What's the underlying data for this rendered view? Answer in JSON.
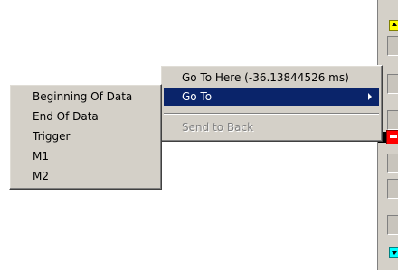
{
  "context_menu": {
    "go_to_here": "Go To Here (-36.13844526 ms)",
    "go_to": "Go To",
    "send_to_back": "Send to Back"
  },
  "go_to_submenu": {
    "items": [
      "Beginning Of Data",
      "End Of Data",
      "Trigger",
      "M1",
      "M2"
    ]
  },
  "colors": {
    "menu_bg": "#d4d0c8",
    "selection": "#0a246a",
    "top_marker": "#ffff00",
    "bottom_marker": "#00ffff",
    "cursor_marker": "#ff0000"
  }
}
